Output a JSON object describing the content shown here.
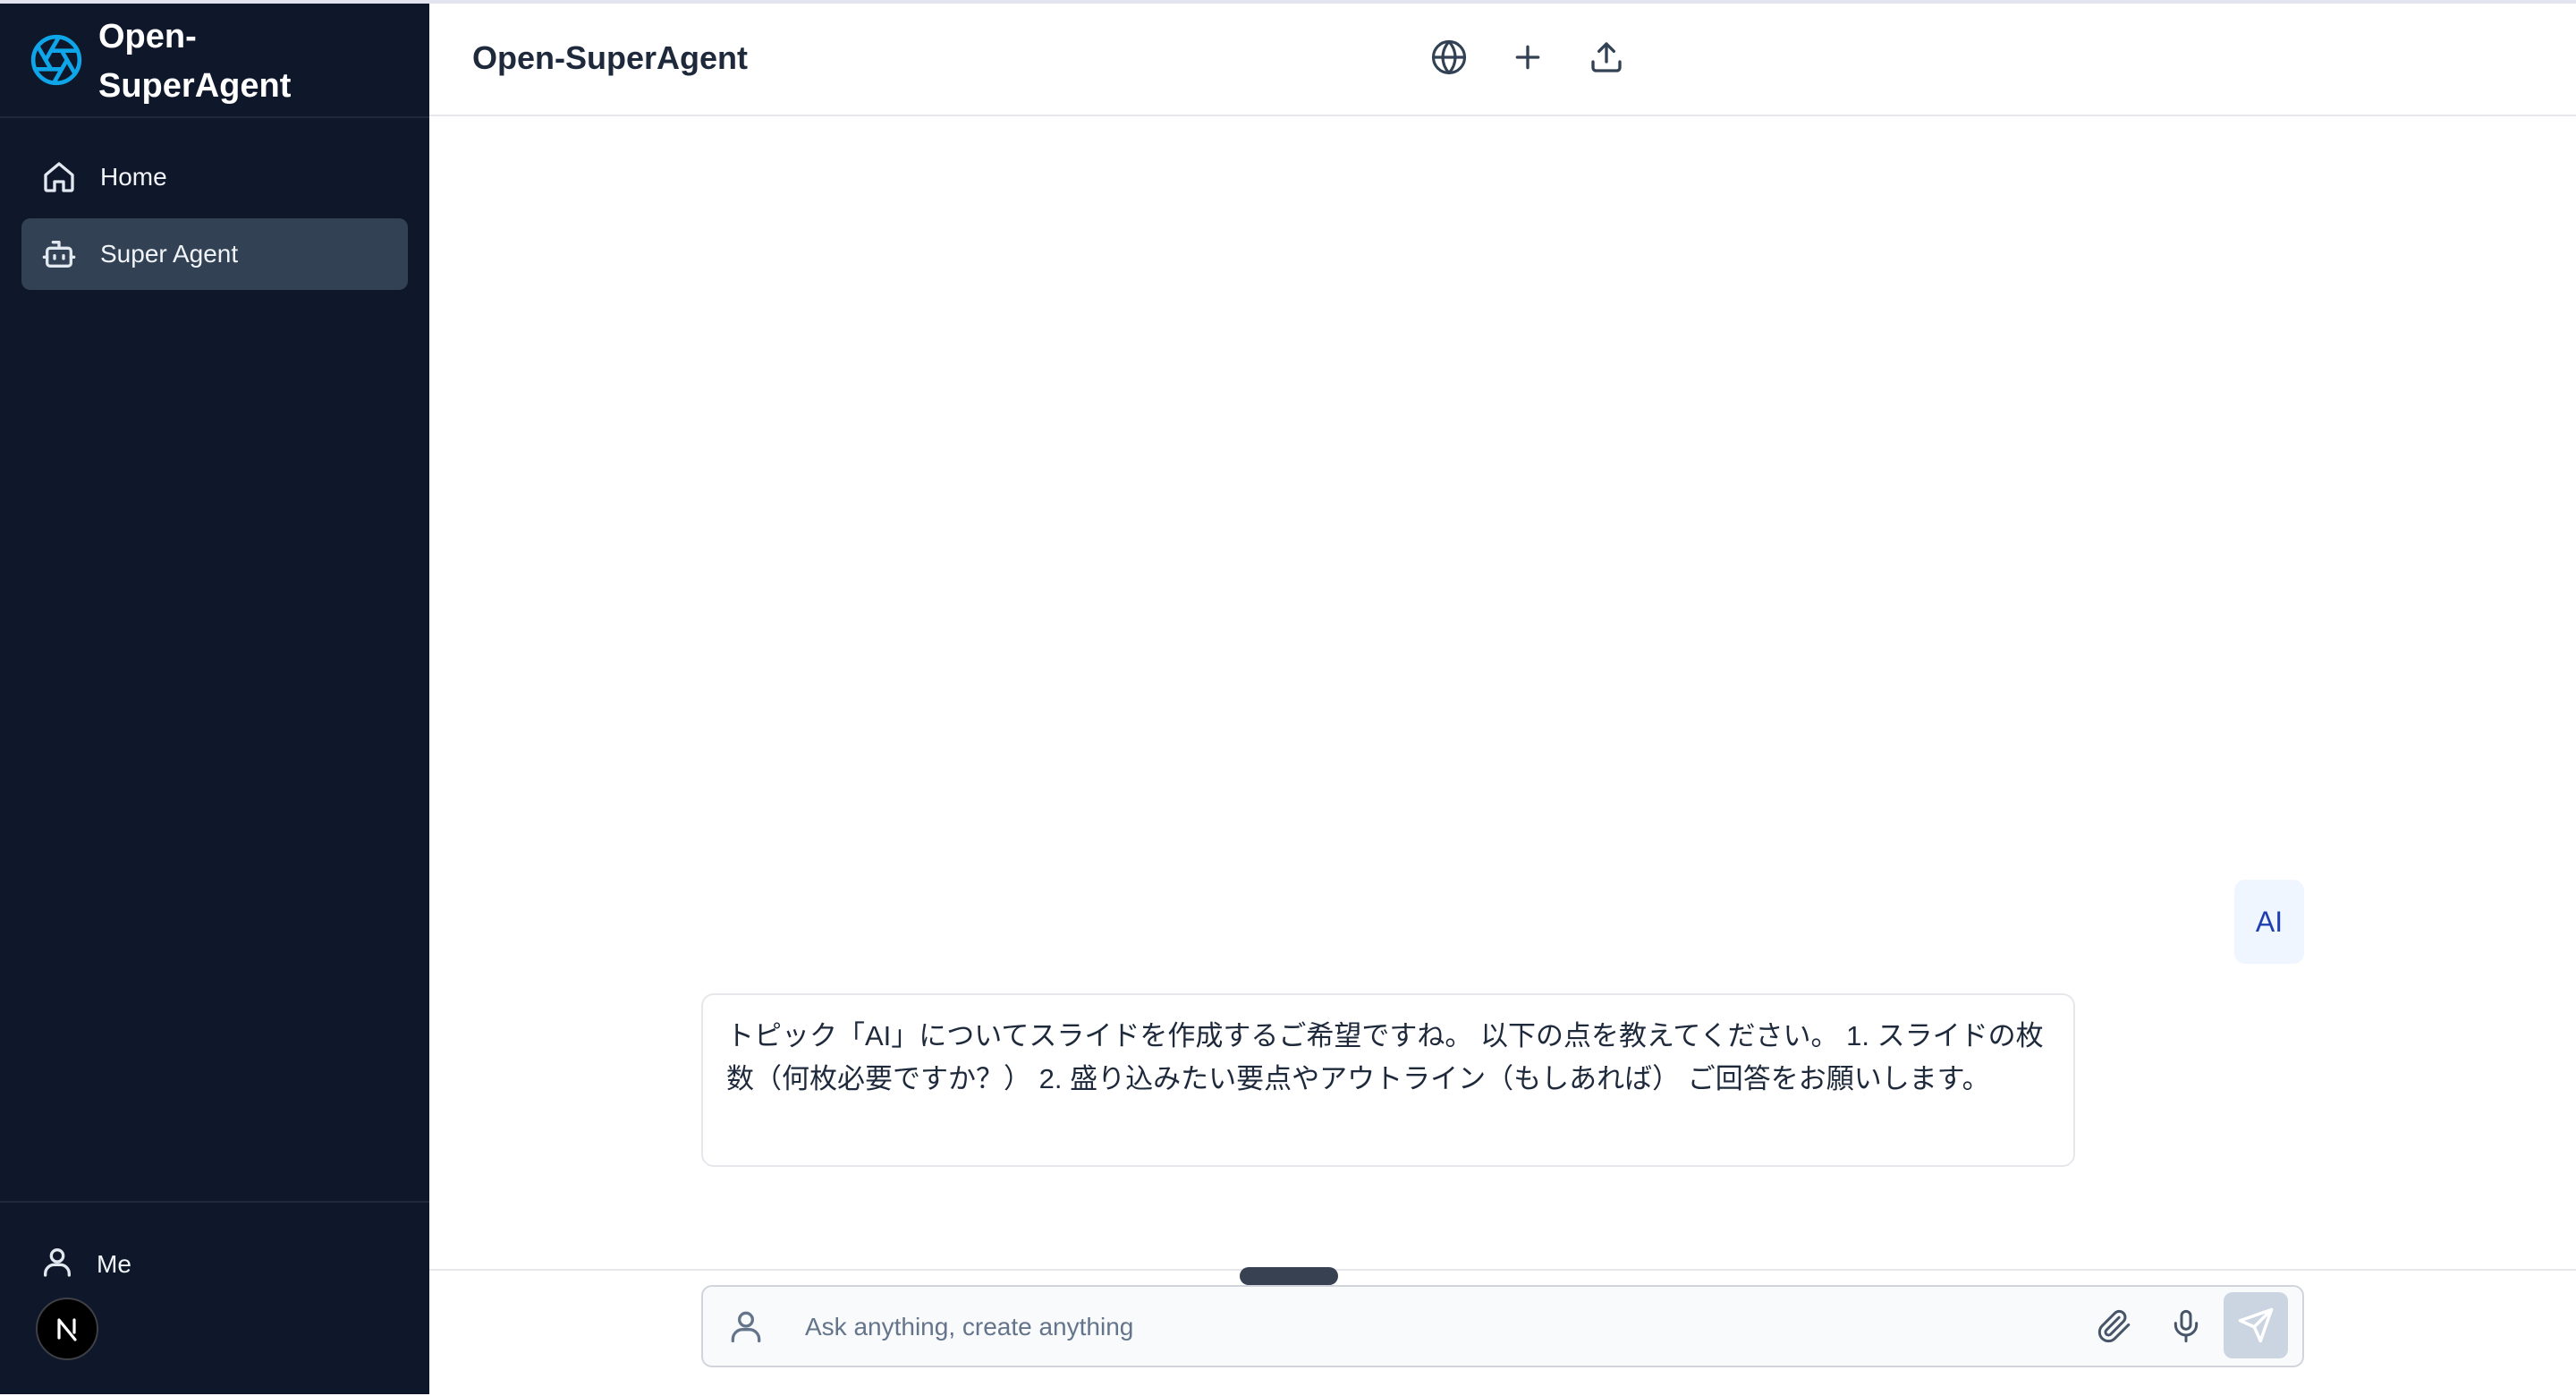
{
  "app": {
    "brand_title": "Open-\nSuperAgent",
    "logo_icon": "aperture-logo-icon",
    "accent_color": "#0ea5e9",
    "sidebar_bg": "#0f172a"
  },
  "sidebar": {
    "items": [
      {
        "label": "Home",
        "icon": "home-icon",
        "active": false
      },
      {
        "label": "Super Agent",
        "icon": "bot-icon",
        "active": true
      }
    ],
    "footer": {
      "me_label": "Me",
      "me_icon": "user-icon",
      "avatar_icon": "n-logo-icon",
      "avatar_letter": "N"
    }
  },
  "header": {
    "title": "Open-SuperAgent",
    "actions": [
      {
        "name": "language",
        "icon": "globe-icon"
      },
      {
        "name": "new-chat",
        "icon": "plus-icon"
      },
      {
        "name": "share",
        "icon": "upload-icon"
      }
    ]
  },
  "chat": {
    "user_message": "AI",
    "assistant_message": "トピック「AI」についてスライドを作成するご希望ですね。 以下の点を教えてください。 1. スライドの枚数（何枚必要ですか？） 2. 盛り込みたい要点やアウトライン（もしあれば） ご回答をお願いします。"
  },
  "composer": {
    "placeholder": "Ask anything, create anything",
    "value": "",
    "left_icon": "user-icon",
    "attach_icon": "paperclip-icon",
    "mic_icon": "microphone-icon",
    "send_icon": "send-icon"
  }
}
